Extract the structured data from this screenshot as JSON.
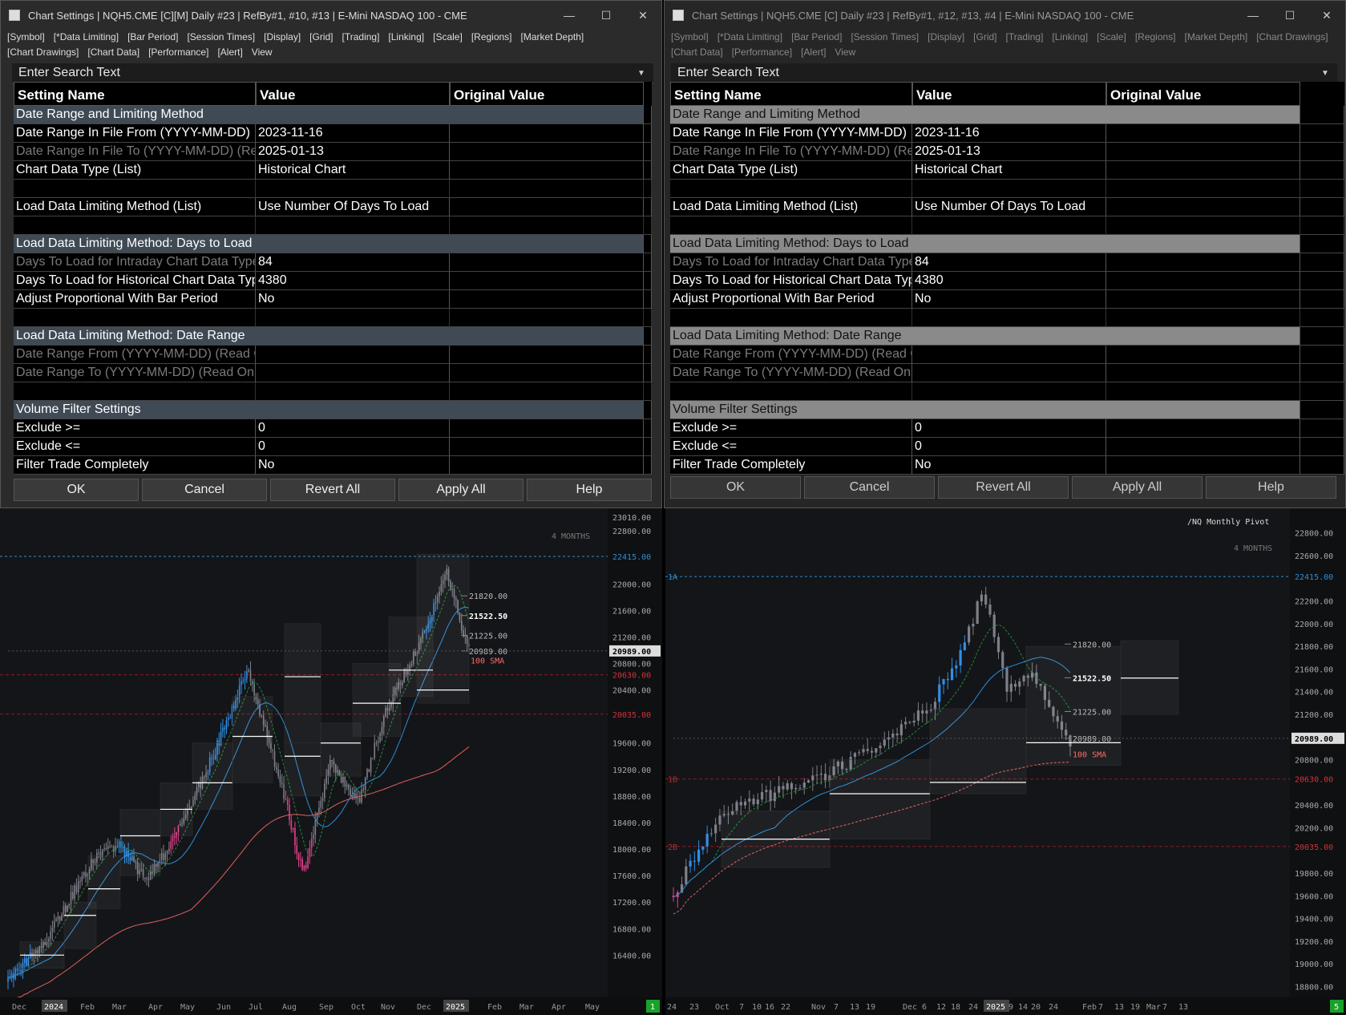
{
  "left": {
    "title": "Chart Settings | NQH5.CME [C][M]  Daily #23 | RefBy#1, #10, #13 | E-Mini NASDAQ 100 - CME",
    "menus": [
      "[Symbol]",
      "[*Data Limiting]",
      "[Bar Period]",
      "[Session Times]",
      "[Display]",
      "[Grid]",
      "[Trading]",
      "[Linking]",
      "[Scale]",
      "[Regions]",
      "[Market Depth]",
      "[Chart Drawings]",
      "[Chart Data]",
      "[Performance]",
      "[Alert]",
      "View"
    ],
    "buttons": [
      "OK",
      "Cancel",
      "Revert All",
      "Apply All",
      "Help"
    ]
  },
  "right": {
    "title": "Chart Settings | NQH5.CME [C]  Daily #23 | RefBy#1, #12, #13, #4 | E-Mini NASDAQ 100 - CME",
    "menus": [
      "[Symbol]",
      "[*Data Limiting]",
      "[Bar Period]",
      "[Session Times]",
      "[Display]",
      "[Grid]",
      "[Trading]",
      "[Linking]",
      "[Scale]",
      "[Regions]",
      "[Market Depth]",
      "[Chart Drawings]",
      "[Chart Data]",
      "[Performance]",
      "[Alert]",
      "View"
    ],
    "buttons": [
      "OK",
      "Cancel",
      "Revert All",
      "Apply All",
      "Help"
    ]
  },
  "search_placeholder": "Enter Search Text",
  "columns": [
    "Setting Name",
    "Value",
    "Original Value"
  ],
  "rows": [
    {
      "type": "sec",
      "name": "Date Range and Limiting Method",
      "value": ""
    },
    {
      "type": "row",
      "name": "Date Range In File From (YYYY-MM-DD)",
      "value": "2023-11-16"
    },
    {
      "type": "dim",
      "name": "Date Range In File To (YYYY-MM-DD) (Re",
      "value": "2025-01-13"
    },
    {
      "type": "row",
      "name": "Chart Data Type (List)",
      "value": "Historical Chart"
    },
    {
      "type": "blank",
      "name": "",
      "value": ""
    },
    {
      "type": "row",
      "name": "Load Data Limiting Method (List)",
      "value": "Use Number Of Days To Load"
    },
    {
      "type": "blank",
      "name": "",
      "value": ""
    },
    {
      "type": "sec",
      "name": "Load Data Limiting Method: Days to Load",
      "value": ""
    },
    {
      "type": "dim",
      "name": "Days To Load for Intraday Chart Data Type",
      "value": "84"
    },
    {
      "type": "row",
      "name": "Days To Load for Historical Chart Data Typ",
      "value": "4380"
    },
    {
      "type": "row",
      "name": "Adjust Proportional With Bar Period",
      "value": "No"
    },
    {
      "type": "blank",
      "name": "",
      "value": ""
    },
    {
      "type": "sec",
      "name": "Load Data Limiting Method: Date Range",
      "value": ""
    },
    {
      "type": "dim",
      "name": "Date Range From (YYYY-MM-DD) (Read C",
      "value": ""
    },
    {
      "type": "dim",
      "name": "Date Range To (YYYY-MM-DD) (Read On",
      "value": ""
    },
    {
      "type": "blank",
      "name": "",
      "value": ""
    },
    {
      "type": "sec",
      "name": "Volume Filter Settings",
      "value": ""
    },
    {
      "type": "row",
      "name": "Exclude >=",
      "value": "0"
    },
    {
      "type": "row",
      "name": "Exclude <=",
      "value": "0"
    },
    {
      "type": "row",
      "name": "Filter Trade Completely",
      "value": "No"
    }
  ],
  "chart_left": {
    "price_labels": [
      "23010.00",
      "22800.00",
      "22415.00",
      "22000.00",
      "21600.00",
      "21200.00",
      "20989.00",
      "20800.00",
      "20630.00",
      "20400.00",
      "20035.00",
      "19600.00",
      "19200.00",
      "18800.00",
      "18400.00",
      "18000.00",
      "17600.00",
      "17200.00",
      "16800.00",
      "16400.00"
    ],
    "x_labels": [
      "Dec",
      "2024",
      "Feb",
      "Mar",
      "Apr",
      "May",
      "Jun",
      "Jul",
      "Aug",
      "Sep",
      "Oct",
      "Nov",
      "Dec",
      "2025",
      "Feb",
      "Mar",
      "Apr",
      "May"
    ],
    "level_labels": [
      "21820.00",
      "21522.50",
      "21225.00",
      "20989.00"
    ],
    "sma_label": "100 SMA",
    "period_label": "4 MONTHS",
    "badge": "1"
  },
  "chart_right": {
    "price_labels": [
      "22800.00",
      "22600.00",
      "22415.00",
      "22200.00",
      "22000.00",
      "21800.00",
      "21600.00",
      "21400.00",
      "21200.00",
      "20989.00",
      "20800.00",
      "20630.00",
      "20400.00",
      "20200.00",
      "20035.00",
      "19800.00",
      "19600.00",
      "19400.00",
      "19200.00",
      "19000.00",
      "18800.00"
    ],
    "x_labels": [
      "24",
      "23",
      "Oct",
      "7",
      "10",
      "16",
      "22",
      "Nov",
      "7",
      "13",
      "19",
      "Dec",
      "6",
      "12",
      "18",
      "24",
      "2025",
      "9",
      "14",
      "20",
      "24",
      "Feb",
      "7",
      "13",
      "19",
      "Mar",
      "7",
      "13"
    ],
    "level_labels": [
      "21820.00",
      "21522.50",
      "21225.00",
      "20989.00"
    ],
    "sma_label": "100 SMA",
    "period_label": "4 MONTHS",
    "study_title": "/NQ Monthly Pivot",
    "pivot_tags": [
      "1A",
      "1B",
      "2B"
    ],
    "badge": "5"
  }
}
